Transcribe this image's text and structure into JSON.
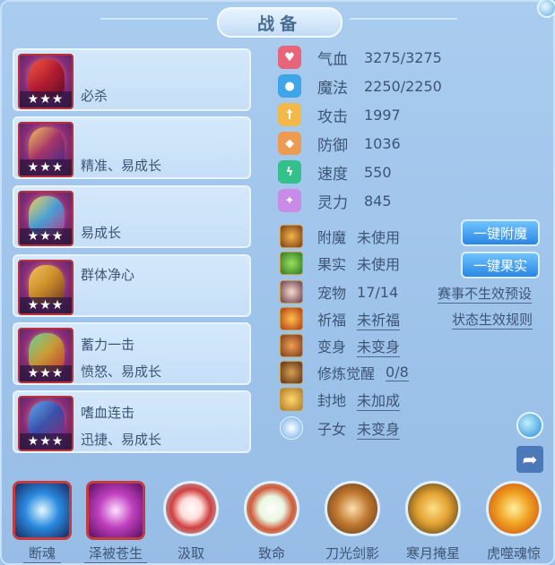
{
  "window": {
    "title": "战备"
  },
  "equipment": [
    {
      "icon": "crimson-sword-icon",
      "stars": "★★★",
      "line1": "",
      "line2": "必杀"
    },
    {
      "icon": "golden-armor-icon",
      "stars": "★★★",
      "line1": "",
      "line2": "精准、易成长"
    },
    {
      "icon": "jeweled-crown-icon",
      "stars": "★★★",
      "line1": "",
      "line2": "易成长"
    },
    {
      "icon": "dragon-charm-icon",
      "stars": "★★★",
      "line1": "群体净心",
      "line2": ""
    },
    {
      "icon": "jade-bowl-icon",
      "stars": "★★★",
      "line1": "蓄力一击",
      "line2": "愤怒、易成长"
    },
    {
      "icon": "blue-boots-icon",
      "stars": "★★★",
      "line1": "嗜血连击",
      "line2": "迅捷、易成长"
    }
  ],
  "attributes": [
    {
      "icon": "heart-icon",
      "color": "#e8647a",
      "label": "气血",
      "value": "3275/3275"
    },
    {
      "icon": "mana-icon",
      "color": "#3fa4e8",
      "label": "魔法",
      "value": "2250/2250"
    },
    {
      "icon": "sword-icon",
      "color": "#f2b84a",
      "label": "攻击",
      "value": "1997"
    },
    {
      "icon": "shield-icon",
      "color": "#ee9a50",
      "label": "防御",
      "value": "1036"
    },
    {
      "icon": "lightning-icon",
      "color": "#33c08a",
      "label": "速度",
      "value": "550"
    },
    {
      "icon": "spirit-icon",
      "color": "#c98ae8",
      "label": "灵力",
      "value": "845"
    }
  ],
  "misc": [
    {
      "icon": "enchant-icon",
      "label": "附魔",
      "value": "未使用"
    },
    {
      "icon": "fruit-icon",
      "label": "果实",
      "value": "未使用"
    },
    {
      "icon": "pet-avatar-icon",
      "label": "宠物",
      "value": "17/14"
    },
    {
      "icon": "blessing-icon",
      "label": "祈福",
      "value": "未祈福"
    },
    {
      "icon": "transform-icon",
      "label": "变身",
      "value": "未变身"
    },
    {
      "icon": "cultivation-icon",
      "label": "修炼觉醒",
      "value": "0/8"
    },
    {
      "icon": "seal-icon",
      "label": "封地",
      "value": "未加成"
    },
    {
      "icon": "child-flame-icon",
      "label": "子女",
      "value": "未变身"
    }
  ],
  "buttons": {
    "enchant": "一键附魔",
    "fruit": "一键果实"
  },
  "links": {
    "event_preset": "赛事不生效预设",
    "status_rules": "状态生效规则"
  },
  "skills": [
    {
      "icon": "break-soul-icon",
      "label": "断魂"
    },
    {
      "icon": "blessed-life-icon",
      "label": "泽被苍生"
    },
    {
      "icon": "absorb-icon",
      "label": "汲取"
    },
    {
      "icon": "fatal-icon",
      "label": "致命"
    },
    {
      "icon": "blade-shadow-icon",
      "label": "刀光剑影"
    },
    {
      "icon": "cold-moon-icon",
      "label": "寒月掩星"
    },
    {
      "icon": "tiger-soul-icon",
      "label": "虎噬魂惊"
    }
  ]
}
